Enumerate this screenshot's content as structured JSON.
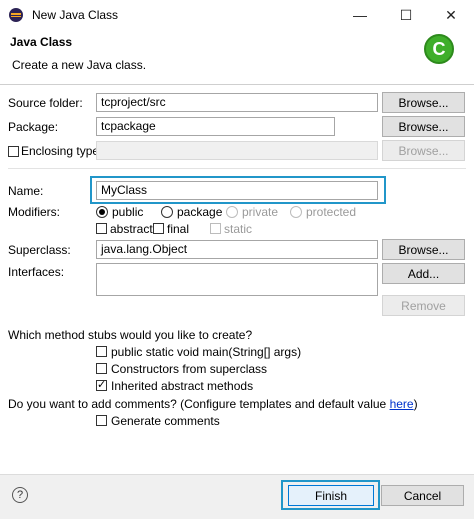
{
  "window": {
    "title": "New Java Class",
    "minimize_glyph": "—",
    "maximize_glyph": "☐",
    "close_glyph": "✕"
  },
  "header": {
    "title": "Java Class",
    "description": "Create a new Java class.",
    "icon_letter": "C"
  },
  "form": {
    "source_folder": {
      "label": "Source folder:",
      "value": "tcproject/src",
      "browse": "Browse..."
    },
    "package": {
      "label": "Package:",
      "value": "tcpackage",
      "browse": "Browse..."
    },
    "enclosing_type": {
      "label": "Enclosing type:",
      "value": "",
      "browse": "Browse...",
      "checked": false
    },
    "name": {
      "label": "Name:",
      "value": "MyClass"
    },
    "modifiers": {
      "label": "Modifiers:",
      "public": "public",
      "package": "package",
      "private": "private",
      "protected": "protected",
      "abstract": "abstract",
      "final": "final",
      "static": "static"
    },
    "superclass": {
      "label": "Superclass:",
      "value": "java.lang.Object",
      "browse": "Browse..."
    },
    "interfaces": {
      "label": "Interfaces:",
      "add": "Add...",
      "remove": "Remove"
    }
  },
  "stubs": {
    "question": "Which method stubs would you like to create?",
    "main": "public static void main(String[] args)",
    "constructors": "Constructors from superclass",
    "inherited": "Inherited abstract methods"
  },
  "comments": {
    "question": "Do you want to add comments? (Configure templates and default value ",
    "link": "here",
    "close_paren": ")",
    "generate": "Generate comments"
  },
  "footer": {
    "help_glyph": "?",
    "finish": "Finish",
    "cancel": "Cancel"
  },
  "colors": {
    "highlight": "#2196c9",
    "link": "#0033cc"
  }
}
